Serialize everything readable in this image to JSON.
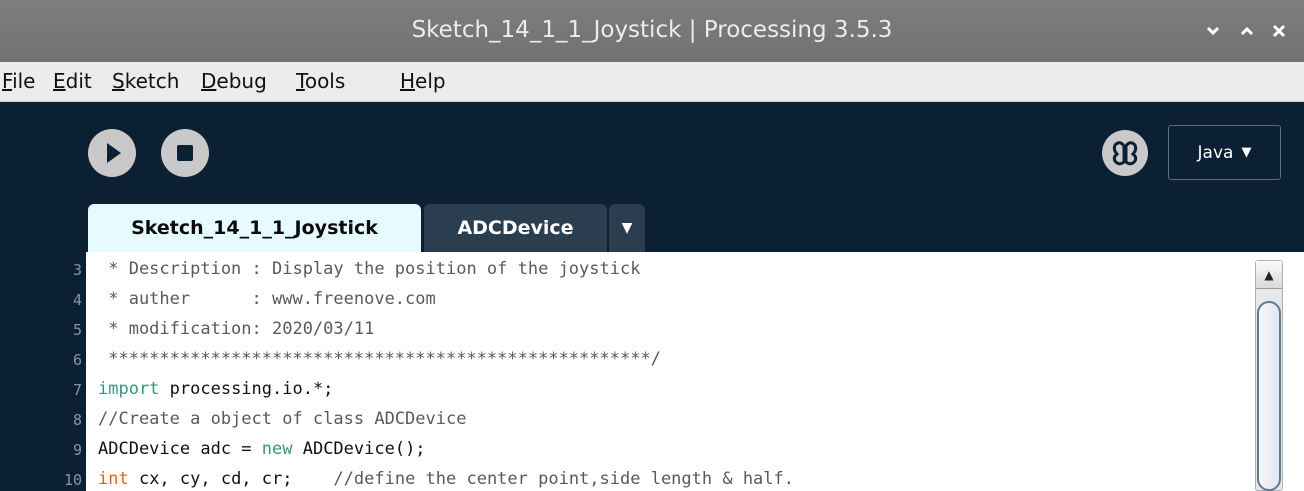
{
  "window": {
    "title": "Sketch_14_1_1_Joystick | Processing 3.5.3",
    "controls": [
      "chevron-down-icon",
      "chevron-up-icon",
      "close-icon"
    ]
  },
  "menu": {
    "items": [
      {
        "label": "File",
        "mnemonic": "F",
        "rest": "ile"
      },
      {
        "label": "Edit",
        "mnemonic": "E",
        "rest": "dit"
      },
      {
        "label": "Sketch",
        "mnemonic": "S",
        "rest": "ketch"
      },
      {
        "label": "Debug",
        "mnemonic": "D",
        "rest": "ebug"
      },
      {
        "label": "Tools",
        "mnemonic": "T",
        "rest": "ools"
      },
      {
        "label": "Help",
        "mnemonic": "H",
        "rest": "elp"
      }
    ]
  },
  "toolbar": {
    "run_icon": "play-icon",
    "stop_icon": "stop-icon",
    "debugger_icon": "butterfly-icon",
    "mode": "Java",
    "mode_arrow": "▼"
  },
  "tabs": {
    "active": "Sketch_14_1_1_Joystick",
    "inactive": "ADCDevice",
    "more": "▼"
  },
  "editor": {
    "lines": [
      {
        "num": "3",
        "text": " * Description : Display the position of the joystick"
      },
      {
        "num": "4",
        "text": " * auther      : www.freenove.com"
      },
      {
        "num": "5",
        "text": " * modification: 2020/03/11"
      },
      {
        "num": "6",
        "text": " *****************************************************/"
      },
      {
        "num": "7",
        "kw": "import",
        "rest": " processing.io.*;"
      },
      {
        "num": "8",
        "text": "//Create a object of class ADCDevice"
      },
      {
        "num": "9",
        "pre": "ADCDevice adc = ",
        "kw": "new",
        "rest": " ADCDevice();"
      },
      {
        "num": "10",
        "kw": "int",
        "rest": " cx, cy, cd, cr;",
        "comment": "    //define the center point,side length & half."
      }
    ]
  },
  "colors": {
    "background": "#0b2133",
    "titlebar": "#777777",
    "tab_active": "#e6fbff",
    "tab_inactive": "#2a3e4f",
    "keyword_green": "#33997e",
    "keyword_orange": "#e2661a",
    "comment": "#5a5a5a"
  }
}
